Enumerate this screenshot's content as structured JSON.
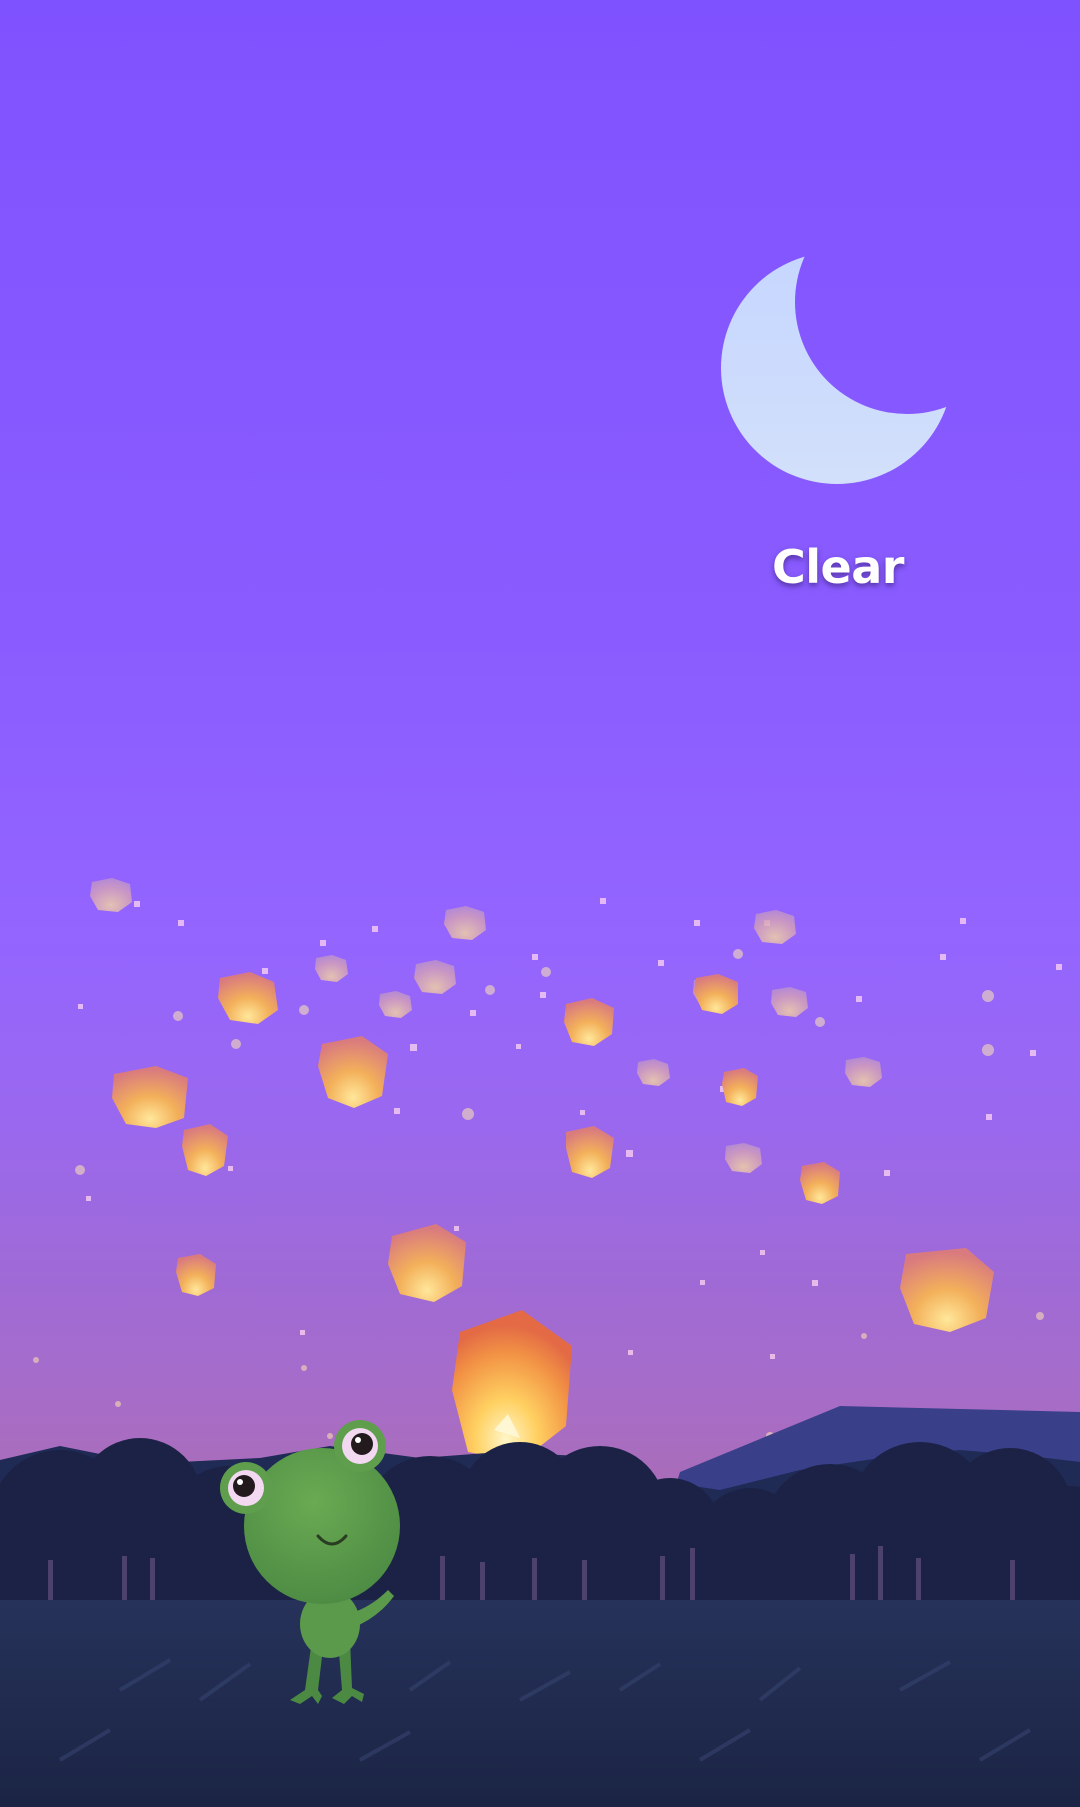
{
  "weather": {
    "condition_label": "Clear",
    "condition_icon": "crescent-moon-icon",
    "time_of_day": "night"
  },
  "scene": {
    "character": "frog-mascot",
    "decorations": "sky-lanterns"
  },
  "colors": {
    "sky_top": "#7f52ff",
    "sky_horizon": "#a86dc2",
    "moon": "#c8d8ff",
    "lantern_glow": "#ffd56a",
    "lantern_shell": "#f08a4b",
    "frog": "#5f9e4c",
    "ground": "#202a4a"
  }
}
